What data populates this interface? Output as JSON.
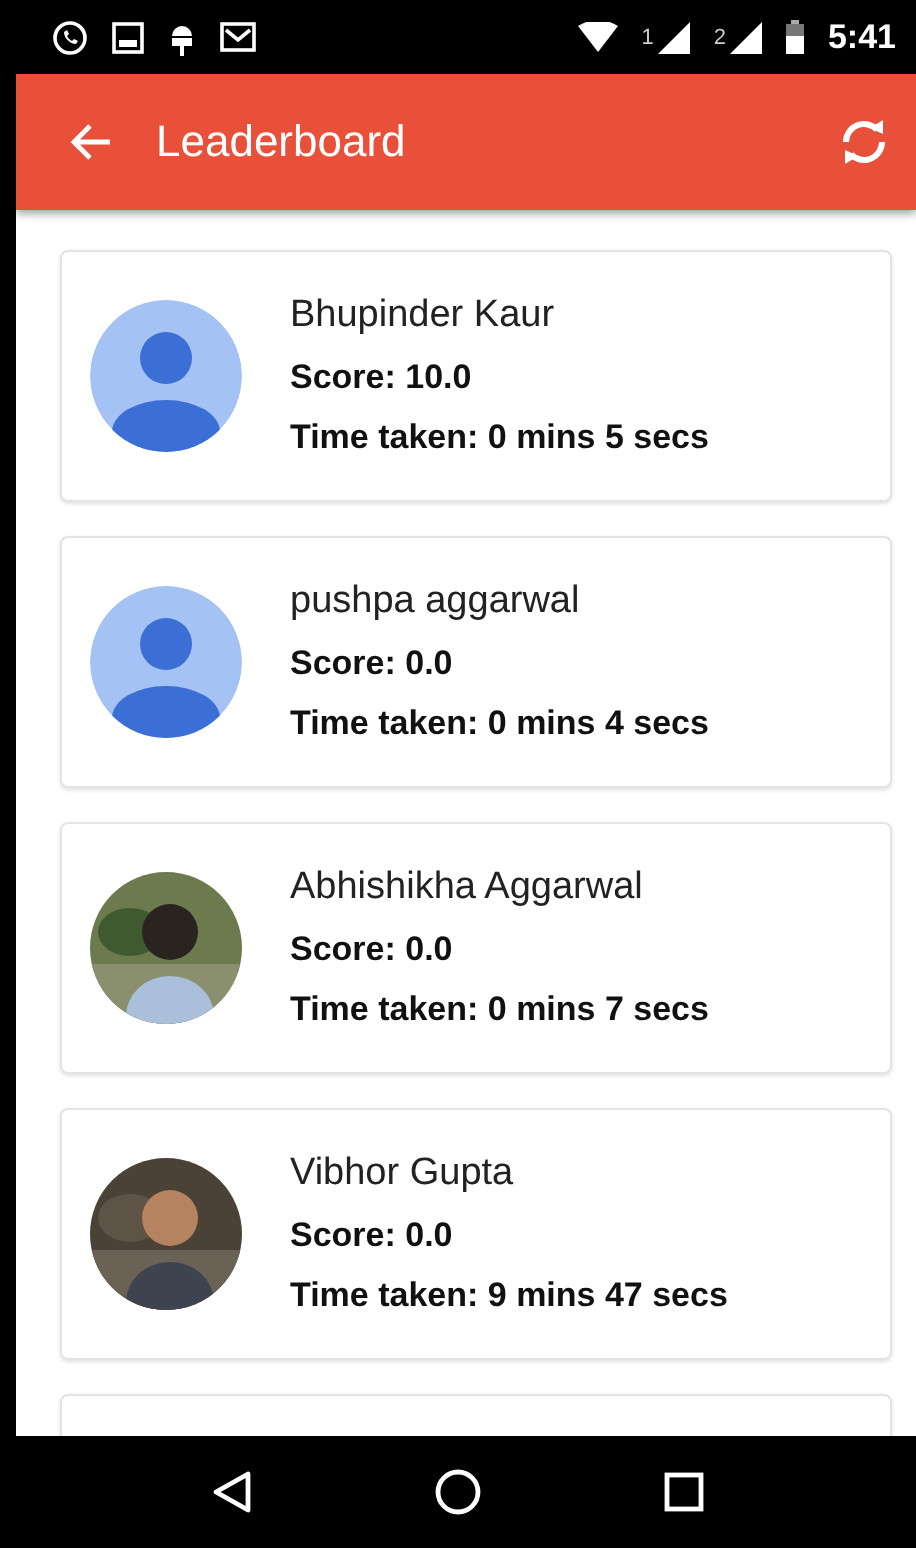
{
  "status_bar": {
    "sim_1": "1",
    "sim_2": "2",
    "time": "5:41"
  },
  "app_bar": {
    "title": "Leaderboard"
  },
  "entries": [
    {
      "name": "Bhupinder Kaur",
      "score": "Score: 10.0",
      "time_taken": "Time taken: 0 mins 5 secs",
      "avatar": {
        "kind": "default"
      }
    },
    {
      "name": "pushpa aggarwal",
      "score": "Score: 0.0",
      "time_taken": "Time taken: 0 mins 4 secs",
      "avatar": {
        "kind": "default"
      }
    },
    {
      "name": "Abhishikha Aggarwal",
      "score": "Score: 0.0",
      "time_taken": "Time taken: 0 mins 7 secs"
    },
    {
      "name": "Vibhor Gupta",
      "score": "Score: 0.0",
      "time_taken": "Time taken: 9 mins 47 secs"
    }
  ]
}
